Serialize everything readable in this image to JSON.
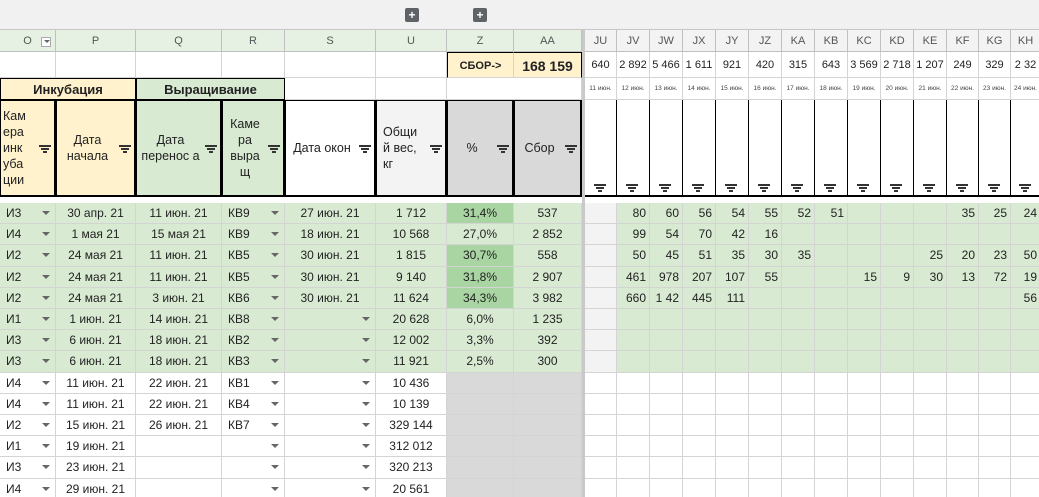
{
  "colors": {
    "green": "#d9ead3",
    "yellow": "#fff2cc",
    "darkgreen": "#a8d5a2",
    "gray": "#d9d9d9",
    "header": "#e6f1e3"
  },
  "toolbar": {
    "expand1": "+",
    "expand2": "+"
  },
  "columns_left": [
    "O",
    "P",
    "Q",
    "R",
    "S",
    "U",
    "Z",
    "AA"
  ],
  "columns_right": [
    "JU",
    "JV",
    "JW",
    "JX",
    "JY",
    "JZ",
    "KA",
    "KB",
    "KC",
    "KD",
    "KE",
    "KF",
    "KG",
    "KH"
  ],
  "summary": {
    "sbor_label": "СБОР->",
    "sbor_total": "168 159"
  },
  "groups": {
    "incubation": "Инкубация",
    "growing": "Выращивание"
  },
  "headers": {
    "o": "Кам ера инк уба ции",
    "p": "Дата начала",
    "q": "Дата перенос а",
    "r": "Каме ра выра щ",
    "s": "Дата окон",
    "u": "Общи й вес, кг",
    "z": "%",
    "aa": "Сбор"
  },
  "day_totals": [
    "640",
    "2 892",
    "5 466",
    "1 611",
    "921",
    "420",
    "315",
    "643",
    "3 569",
    "2 718",
    "1 207",
    "249",
    "329",
    "2 32"
  ],
  "day_dates": [
    "11 июн.",
    "12 июн.",
    "13 июн.",
    "14 июн.",
    "15 июн.",
    "16 июн.",
    "17 июн.",
    "18 июн.",
    "19 июн.",
    "20 июн.",
    "21 июн.",
    "22 июн.",
    "23 июн.",
    "24 июн."
  ],
  "rows": [
    {
      "o": "И3",
      "p": "30 апр. 21",
      "q": "11 июн. 21",
      "r": "КВ9",
      "s": "27 июн. 21",
      "u": "1 712",
      "z": "31,4%",
      "aa": "537",
      "days": [
        "",
        "80",
        "60",
        "56",
        "54",
        "55",
        "52",
        "51",
        "",
        "",
        "",
        "35",
        "25",
        "24"
      ]
    },
    {
      "o": "И4",
      "p": "1 мая 21",
      "q": "15 мая 21",
      "r": "КВ9",
      "s": "18 июн. 21",
      "u": "10 568",
      "z": "27,0%",
      "aa": "2 852",
      "days": [
        "",
        "99",
        "54",
        "70",
        "42",
        "16",
        "",
        "",
        "",
        "",
        "",
        "",
        "",
        ""
      ]
    },
    {
      "o": "И2",
      "p": "24 мая 21",
      "q": "11 июн. 21",
      "r": "КВ5",
      "s": "30 июн. 21",
      "u": "1 815",
      "z": "30,7%",
      "aa": "558",
      "days": [
        "",
        "50",
        "45",
        "51",
        "35",
        "30",
        "35",
        "",
        "",
        "",
        "25",
        "20",
        "23",
        "50"
      ]
    },
    {
      "o": "И2",
      "p": "24 мая 21",
      "q": "11 июн. 21",
      "r": "КВ5",
      "s": "30 июн. 21",
      "u": "9 140",
      "z": "31,8%",
      "aa": "2 907",
      "days": [
        "",
        "461",
        "978",
        "207",
        "107",
        "55",
        "",
        "",
        "15",
        "9",
        "30",
        "13",
        "72",
        "19"
      ]
    },
    {
      "o": "И2",
      "p": "24 мая 21",
      "q": "3 июн. 21",
      "r": "КВ6",
      "s": "30 июн. 21",
      "u": "11 624",
      "z": "34,3%",
      "aa": "3 982",
      "days": [
        "",
        "660",
        "1 42",
        "445",
        "111",
        "",
        "",
        "",
        "",
        "",
        "",
        "",
        "",
        "56"
      ]
    },
    {
      "o": "И1",
      "p": "1 июн. 21",
      "q": "14 июн. 21",
      "r": "КВ8",
      "s": "",
      "u": "20 628",
      "z": "6,0%",
      "aa": "1 235",
      "days": [
        "",
        "",
        "",
        "",
        "",
        "",
        "",
        "",
        "",
        "",
        "",
        "",
        "",
        ""
      ]
    },
    {
      "o": "И3",
      "p": "6 июн. 21",
      "q": "18 июн. 21",
      "r": "КВ2",
      "s": "",
      "u": "12 002",
      "z": "3,3%",
      "aa": "392",
      "days": [
        "",
        "",
        "",
        "",
        "",
        "",
        "",
        "",
        "",
        "",
        "",
        "",
        "",
        ""
      ]
    },
    {
      "o": "И3",
      "p": "6 июн. 21",
      "q": "18 июн. 21",
      "r": "КВ3",
      "s": "",
      "u": "11 921",
      "z": "2,5%",
      "aa": "300",
      "days": [
        "",
        "",
        "",
        "",
        "",
        "",
        "",
        "",
        "",
        "",
        "",
        "",
        "",
        ""
      ]
    },
    {
      "o": "И4",
      "p": "11 июн. 21",
      "q": "22 июн. 21",
      "r": "КВ1",
      "s": "",
      "u": "10 436",
      "z": "",
      "aa": "",
      "days": [
        "",
        "",
        "",
        "",
        "",
        "",
        "",
        "",
        "",
        "",
        "",
        "",
        "",
        ""
      ]
    },
    {
      "o": "И4",
      "p": "11 июн. 21",
      "q": "22 июн. 21",
      "r": "КВ4",
      "s": "",
      "u": "10 139",
      "z": "",
      "aa": "",
      "days": [
        "",
        "",
        "",
        "",
        "",
        "",
        "",
        "",
        "",
        "",
        "",
        "",
        "",
        ""
      ]
    },
    {
      "o": "И2",
      "p": "15 июн. 21",
      "q": "26 июн. 21",
      "r": "КВ7",
      "s": "",
      "u": "329 144",
      "z": "",
      "aa": "",
      "days": [
        "",
        "",
        "",
        "",
        "",
        "",
        "",
        "",
        "",
        "",
        "",
        "",
        "",
        ""
      ]
    },
    {
      "o": "И1",
      "p": "19 июн. 21",
      "q": "",
      "r": "",
      "s": "",
      "u": "312 012",
      "z": "",
      "aa": "",
      "days": [
        "",
        "",
        "",
        "",
        "",
        "",
        "",
        "",
        "",
        "",
        "",
        "",
        "",
        ""
      ]
    },
    {
      "o": "И3",
      "p": "23 июн. 21",
      "q": "",
      "r": "",
      "s": "",
      "u": "320 213",
      "z": "",
      "aa": "",
      "days": [
        "",
        "",
        "",
        "",
        "",
        "",
        "",
        "",
        "",
        "",
        "",
        "",
        "",
        ""
      ]
    },
    {
      "o": "И4",
      "p": "29 июн. 21",
      "q": "",
      "r": "",
      "s": "",
      "u": "20 561",
      "z": "",
      "aa": "",
      "days": [
        "",
        "",
        "",
        "",
        "",
        "",
        "",
        "",
        "",
        "",
        "",
        "",
        "",
        ""
      ]
    }
  ]
}
